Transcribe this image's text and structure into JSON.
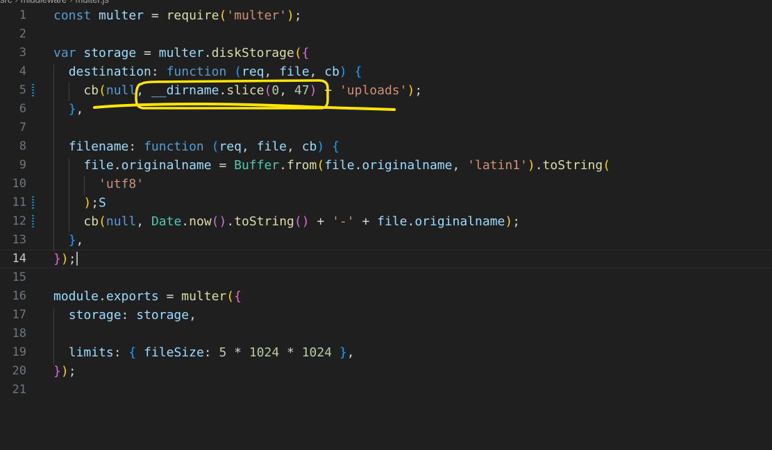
{
  "breadcrumb": [
    "src",
    "middleware",
    "multer.js"
  ],
  "lines": [
    {
      "n": "1",
      "tokens": [
        [
          "kw",
          "const"
        ],
        [
          "op",
          " "
        ],
        [
          "id",
          "multer"
        ],
        [
          "op",
          " = "
        ],
        [
          "fn",
          "require"
        ],
        [
          "b1",
          "("
        ],
        [
          "str",
          "'multer'"
        ],
        [
          "b1",
          ")"
        ],
        [
          "op",
          ";"
        ]
      ]
    },
    {
      "n": "2",
      "tokens": []
    },
    {
      "n": "3",
      "tokens": [
        [
          "kw",
          "var"
        ],
        [
          "op",
          " "
        ],
        [
          "id",
          "storage"
        ],
        [
          "op",
          " = "
        ],
        [
          "id",
          "multer"
        ],
        [
          "op",
          "."
        ],
        [
          "fn",
          "diskStorage"
        ],
        [
          "b1",
          "("
        ],
        [
          "b2",
          "{"
        ]
      ]
    },
    {
      "n": "4",
      "tokens": [
        [
          "op",
          "  "
        ],
        [
          "id",
          "destination"
        ],
        [
          "op",
          ": "
        ],
        [
          "kw",
          "function"
        ],
        [
          "op",
          " "
        ],
        [
          "b3",
          "("
        ],
        [
          "id",
          "req"
        ],
        [
          "op",
          ", "
        ],
        [
          "id",
          "file"
        ],
        [
          "op",
          ", "
        ],
        [
          "id",
          "cb"
        ],
        [
          "b3",
          ")"
        ],
        [
          "op",
          " "
        ],
        [
          "b3",
          "{"
        ]
      ]
    },
    {
      "n": "5",
      "modified": true,
      "tokens": [
        [
          "op",
          "    "
        ],
        [
          "fn",
          "cb"
        ],
        [
          "b1",
          "("
        ],
        [
          "kw",
          "null"
        ],
        [
          "op",
          ", "
        ],
        [
          "id",
          "__dirname"
        ],
        [
          "op",
          "."
        ],
        [
          "fn",
          "slice"
        ],
        [
          "b2",
          "("
        ],
        [
          "num",
          "0"
        ],
        [
          "op",
          ", "
        ],
        [
          "num",
          "47"
        ],
        [
          "b2",
          ")"
        ],
        [
          "op",
          " + "
        ],
        [
          "str",
          "'uploads'"
        ],
        [
          "b1",
          ")"
        ],
        [
          "op",
          ";"
        ]
      ]
    },
    {
      "n": "6",
      "tokens": [
        [
          "op",
          "  "
        ],
        [
          "b3",
          "}"
        ],
        [
          "op",
          ","
        ]
      ]
    },
    {
      "n": "7",
      "tokens": []
    },
    {
      "n": "8",
      "tokens": [
        [
          "op",
          "  "
        ],
        [
          "id",
          "filename"
        ],
        [
          "op",
          ": "
        ],
        [
          "kw",
          "function"
        ],
        [
          "op",
          " "
        ],
        [
          "b3",
          "("
        ],
        [
          "id",
          "req"
        ],
        [
          "op",
          ", "
        ],
        [
          "id",
          "file"
        ],
        [
          "op",
          ", "
        ],
        [
          "id",
          "cb"
        ],
        [
          "b3",
          ")"
        ],
        [
          "op",
          " "
        ],
        [
          "b3",
          "{"
        ]
      ]
    },
    {
      "n": "9",
      "tokens": [
        [
          "op",
          "    "
        ],
        [
          "id",
          "file"
        ],
        [
          "op",
          "."
        ],
        [
          "id",
          "originalname"
        ],
        [
          "op",
          " = "
        ],
        [
          "cls",
          "Buffer"
        ],
        [
          "op",
          "."
        ],
        [
          "fn",
          "from"
        ],
        [
          "b1",
          "("
        ],
        [
          "id",
          "file"
        ],
        [
          "op",
          "."
        ],
        [
          "id",
          "originalname"
        ],
        [
          "op",
          ", "
        ],
        [
          "str",
          "'latin1'"
        ],
        [
          "b1",
          ")"
        ],
        [
          "op",
          "."
        ],
        [
          "fn",
          "toString"
        ],
        [
          "b1",
          "("
        ]
      ]
    },
    {
      "n": "10",
      "tokens": [
        [
          "op",
          "      "
        ],
        [
          "str",
          "'utf8'"
        ]
      ]
    },
    {
      "n": "11",
      "modified": true,
      "tokens": [
        [
          "op",
          "    "
        ],
        [
          "b1",
          ")"
        ],
        [
          "op",
          ";"
        ],
        [
          "id",
          "S"
        ]
      ]
    },
    {
      "n": "12",
      "modified": true,
      "tokens": [
        [
          "op",
          "    "
        ],
        [
          "fn",
          "cb"
        ],
        [
          "b1",
          "("
        ],
        [
          "kw",
          "null"
        ],
        [
          "op",
          ", "
        ],
        [
          "cls",
          "Date"
        ],
        [
          "op",
          "."
        ],
        [
          "fn",
          "now"
        ],
        [
          "b2",
          "()"
        ],
        [
          "op",
          "."
        ],
        [
          "fn",
          "toString"
        ],
        [
          "b2",
          "()"
        ],
        [
          "op",
          " + "
        ],
        [
          "str",
          "'-'"
        ],
        [
          "op",
          " + "
        ],
        [
          "id",
          "file"
        ],
        [
          "op",
          "."
        ],
        [
          "id",
          "originalname"
        ],
        [
          "b1",
          ")"
        ],
        [
          "op",
          ";"
        ]
      ]
    },
    {
      "n": "13",
      "tokens": [
        [
          "op",
          "  "
        ],
        [
          "b3",
          "}"
        ],
        [
          "op",
          ","
        ]
      ]
    },
    {
      "n": "14",
      "current": true,
      "cursor": true,
      "tokens": [
        [
          "b2",
          "}"
        ],
        [
          "b1",
          ")"
        ],
        [
          "op",
          ";"
        ]
      ]
    },
    {
      "n": "15",
      "tokens": []
    },
    {
      "n": "16",
      "tokens": [
        [
          "id",
          "module"
        ],
        [
          "op",
          "."
        ],
        [
          "id",
          "exports"
        ],
        [
          "op",
          " = "
        ],
        [
          "fn",
          "multer"
        ],
        [
          "b1",
          "("
        ],
        [
          "b2",
          "{"
        ]
      ]
    },
    {
      "n": "17",
      "tokens": [
        [
          "op",
          "  "
        ],
        [
          "id",
          "storage"
        ],
        [
          "op",
          ": "
        ],
        [
          "id",
          "storage"
        ],
        [
          "op",
          ","
        ]
      ]
    },
    {
      "n": "18",
      "tokens": []
    },
    {
      "n": "19",
      "tokens": [
        [
          "op",
          "  "
        ],
        [
          "id",
          "limits"
        ],
        [
          "op",
          ": "
        ],
        [
          "b3",
          "{"
        ],
        [
          "op",
          " "
        ],
        [
          "id",
          "fileSize"
        ],
        [
          "op",
          ": "
        ],
        [
          "num",
          "5"
        ],
        [
          "op",
          " * "
        ],
        [
          "num",
          "1024"
        ],
        [
          "op",
          " * "
        ],
        [
          "num",
          "1024"
        ],
        [
          "op",
          " "
        ],
        [
          "b3",
          "}"
        ],
        [
          "op",
          ","
        ]
      ]
    },
    {
      "n": "20",
      "tokens": [
        [
          "b2",
          "}"
        ],
        [
          "b1",
          ")"
        ],
        [
          "op",
          ";"
        ]
      ]
    },
    {
      "n": "21",
      "tokens": []
    }
  ],
  "theme": {
    "background": "#1f1f1f",
    "annotation_color": "#ffe600"
  }
}
